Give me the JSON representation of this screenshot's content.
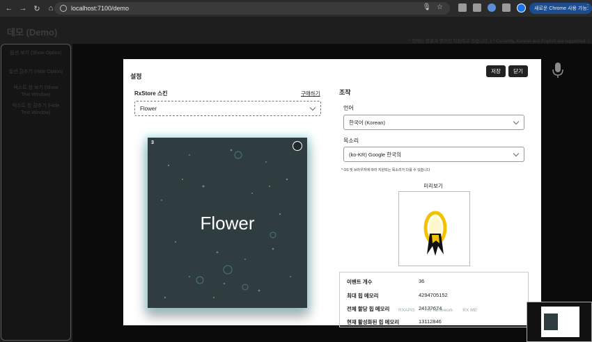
{
  "browser": {
    "url": "localhost:7100/demo",
    "update_label": "새로운 Chrome 사용 가능",
    "menu": "⋮"
  },
  "page": {
    "title": "데모 (Demo)",
    "notice": "* 현재는 한글과 영어만 지원하고 있습니다. ( * Currently, Korean and English are supported. )"
  },
  "sidebar": {
    "items": [
      {
        "label": "옵션 보기 (Show Option)"
      },
      {
        "label": "옵션 감추기 (Hide Option)"
      },
      {
        "label": "텍스트 창 보기 (Show Text Window)"
      },
      {
        "label": "텍스트 창 감추기 (Hide Text Window)"
      }
    ]
  },
  "dialog": {
    "title": "설정",
    "save_label": "저장",
    "close_label": "닫기",
    "skin_label": "RxStore 스킨",
    "buy_label": "구매하기",
    "skin_selected": "Flower",
    "card": {
      "number": "3",
      "name": "Flower"
    },
    "controls_title": "조작",
    "language_label": "언어",
    "language_selected": "한국어 (Korean)",
    "voice_label": "목소리",
    "voice_selected": "(ko-KR) Google 한국의",
    "os_note": "* OS 및 브라우저에 따라 지원되는 목소리가 다를 수 있습니다",
    "preview_label": "미리보기",
    "stats": [
      {
        "key": "이벤트 개수",
        "value": "36"
      },
      {
        "key": "최대 힙 메모리",
        "value": "4294705152"
      },
      {
        "key": "전체 할당 힙 메모리",
        "value": "24132674"
      },
      {
        "key": "현재 활성화된 힙 메모리",
        "value": "13112846"
      }
    ]
  },
  "watermarks": {
    "rx": "RXAPIS",
    "framework": "RxFramework",
    "rxmeta": "RX  ME"
  },
  "colors": {
    "accent": "#1a73e8",
    "card_glow": "#78dce6",
    "card_bg": "#2f3d40"
  }
}
